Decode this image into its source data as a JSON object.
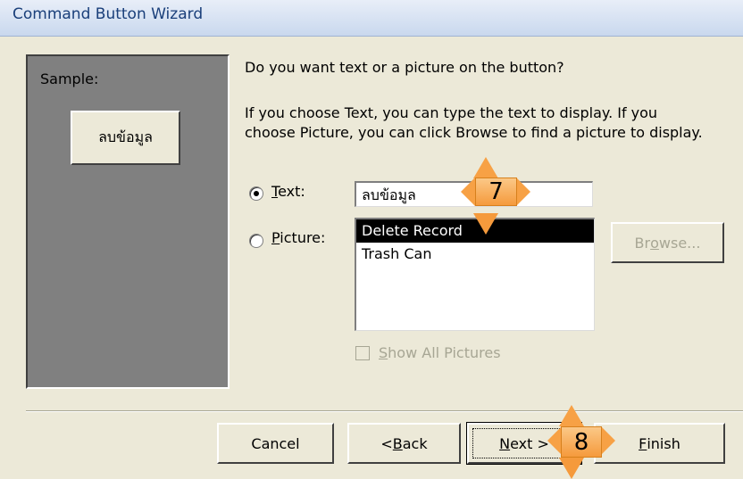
{
  "window": {
    "title": "Command Button Wizard"
  },
  "sample": {
    "label": "Sample:",
    "button_text": "ลบข้อมูล"
  },
  "question": "Do you want text or a picture on the button?",
  "instructions_line1": "If you choose Text, you can type the text to display.  If you",
  "instructions_line2": "choose Picture, you can click Browse to find a picture to display.",
  "options": {
    "text": {
      "mnemonic": "T",
      "rest": "ext:",
      "selected": true,
      "value": "ลบข้อมูล"
    },
    "picture": {
      "mnemonic": "P",
      "rest": "icture:",
      "selected": false
    }
  },
  "picture_list": {
    "items": [
      "Delete Record",
      "Trash Can"
    ],
    "selected_index": 0
  },
  "browse": {
    "pre": "Br",
    "mnemonic": "o",
    "post": "wse...",
    "enabled": false
  },
  "show_all": {
    "mnemonic": "S",
    "rest": "how All Pictures",
    "checked": false,
    "enabled": false
  },
  "buttons": {
    "cancel": "Cancel",
    "back": {
      "pre": "< ",
      "mnemonic": "B",
      "post": "ack"
    },
    "next": {
      "mnemonic": "N",
      "post": "ext >"
    },
    "finish": {
      "mnemonic": "F",
      "post": "inish"
    }
  },
  "callouts": {
    "step7": "7",
    "step8": "8"
  },
  "colors": {
    "dialog_bg": "#ece9d8",
    "sample_bg": "#808080",
    "callout": "#f59a3c",
    "title_text": "#1a3f7a"
  }
}
